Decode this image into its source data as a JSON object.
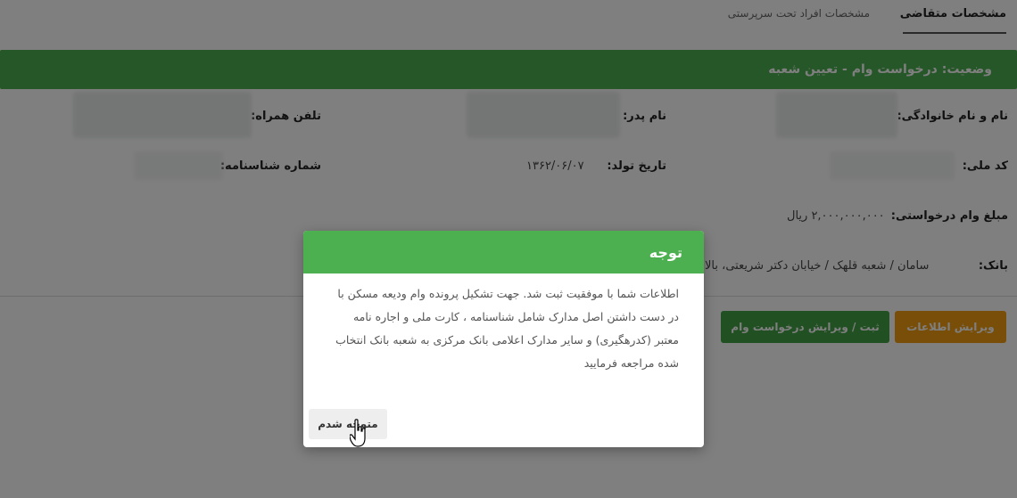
{
  "tabs": [
    {
      "label": "مشخصات متقاضی",
      "active": true
    },
    {
      "label": "مشخصات افراد تحت سرپرستی",
      "active": false
    }
  ],
  "status": {
    "text": "وضعیت: درخواست وام - تعیین شعبه"
  },
  "fields": {
    "full_name_label": "نام و نام خانوادگی:",
    "father_name_label": "نام پدر:",
    "mobile_label": "تلفن همراه:",
    "national_code_label": "کد ملی:",
    "birth_date_label": "تاریخ تولد:",
    "birth_date_value": "۱۳۶۲/۰۶/۰۷",
    "id_number_label": "شماره شناسنامه:",
    "loan_amount_label": "مبلغ وام درخواستی:",
    "loan_amount_value": "۲,۰۰۰,۰۰۰,۰۰۰ ریال",
    "bank_label": "بانک:",
    "bank_value": "سامان / شعبه قلهک / خیابان دکتر شریعتی، بالا"
  },
  "buttons": {
    "edit_info": "ویرایش اطلاعات",
    "submit_loan": "ثبت / ویرایش درخواست وام"
  },
  "modal": {
    "title": "توجه",
    "body": "اطلاعات شما با موفقیت ثبت شد. جهت تشکیل پرونده وام ودیعه مسکن با در دست داشتن اصل مدارک شامل شناسنامه ، کارت ملی و اجاره نامه معتبر (کدرهگیری) و سایر مدارک اعلامی بانک مرکزی به شعبه بانک انتخاب شده مراجعه فرمایید",
    "ok_label": "متوجه شدم"
  },
  "colors": {
    "accent_green": "#4caf50",
    "button_orange": "#f39c12",
    "button_green": "#43a047"
  }
}
